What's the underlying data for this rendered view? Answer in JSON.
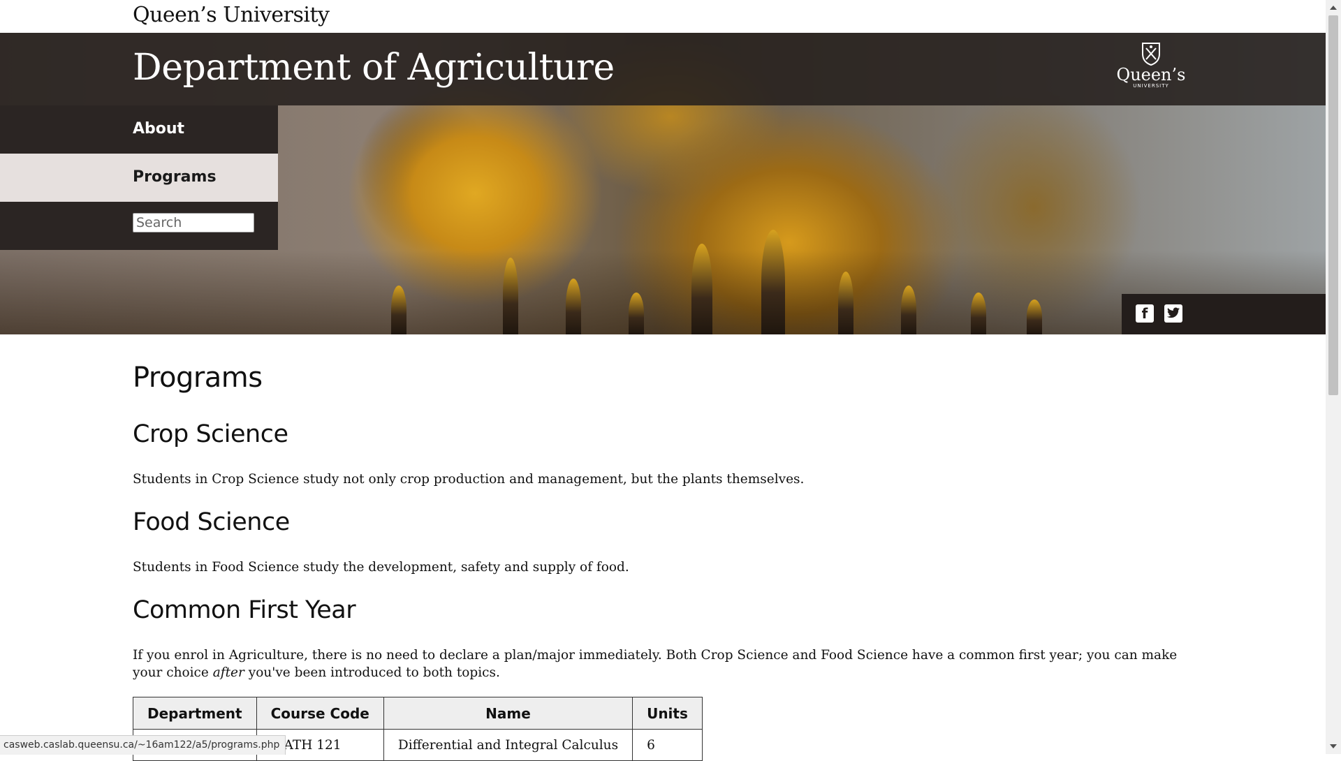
{
  "header": {
    "university": "Queen’s University",
    "department_title": "Department of Agriculture",
    "crest_word": "Queen’s",
    "crest_sub": "UNIVERSITY"
  },
  "nav": {
    "items": [
      {
        "label": "About",
        "active": false
      },
      {
        "label": "Programs",
        "active": true
      }
    ],
    "search_placeholder": "Search"
  },
  "social": {
    "facebook": "f",
    "icons": [
      "facebook-icon",
      "twitter-icon"
    ]
  },
  "main": {
    "page_title": "Programs",
    "sections": [
      {
        "heading": "Crop Science",
        "text": "Students in Crop Science study not only crop production and management, but the plants themselves."
      },
      {
        "heading": "Food Science",
        "text": "Students in Food Science study the development, safety and supply of food."
      },
      {
        "heading": "Common First Year",
        "text_before": "If you enrol in Agriculture, there is no need to declare a plan/major immediately. Both Crop Science and Food Science have a common first year; you can make your choice ",
        "text_em": "after",
        "text_after": " you've been introduced to both topics."
      }
    ],
    "table": {
      "headers": [
        "Department",
        "Course Code",
        "Name",
        "Units"
      ],
      "rows": [
        [
          "",
          "MATH 121",
          "Differential and Integral Calculus",
          "6"
        ]
      ]
    }
  },
  "status_bar": {
    "url": "casweb.caslab.queensu.ca/~16am122/a5/programs.php"
  },
  "colors": {
    "header_band": "#26201e",
    "nav_bg": "#2b2523",
    "nav_active_bg": "#e6e0de"
  }
}
